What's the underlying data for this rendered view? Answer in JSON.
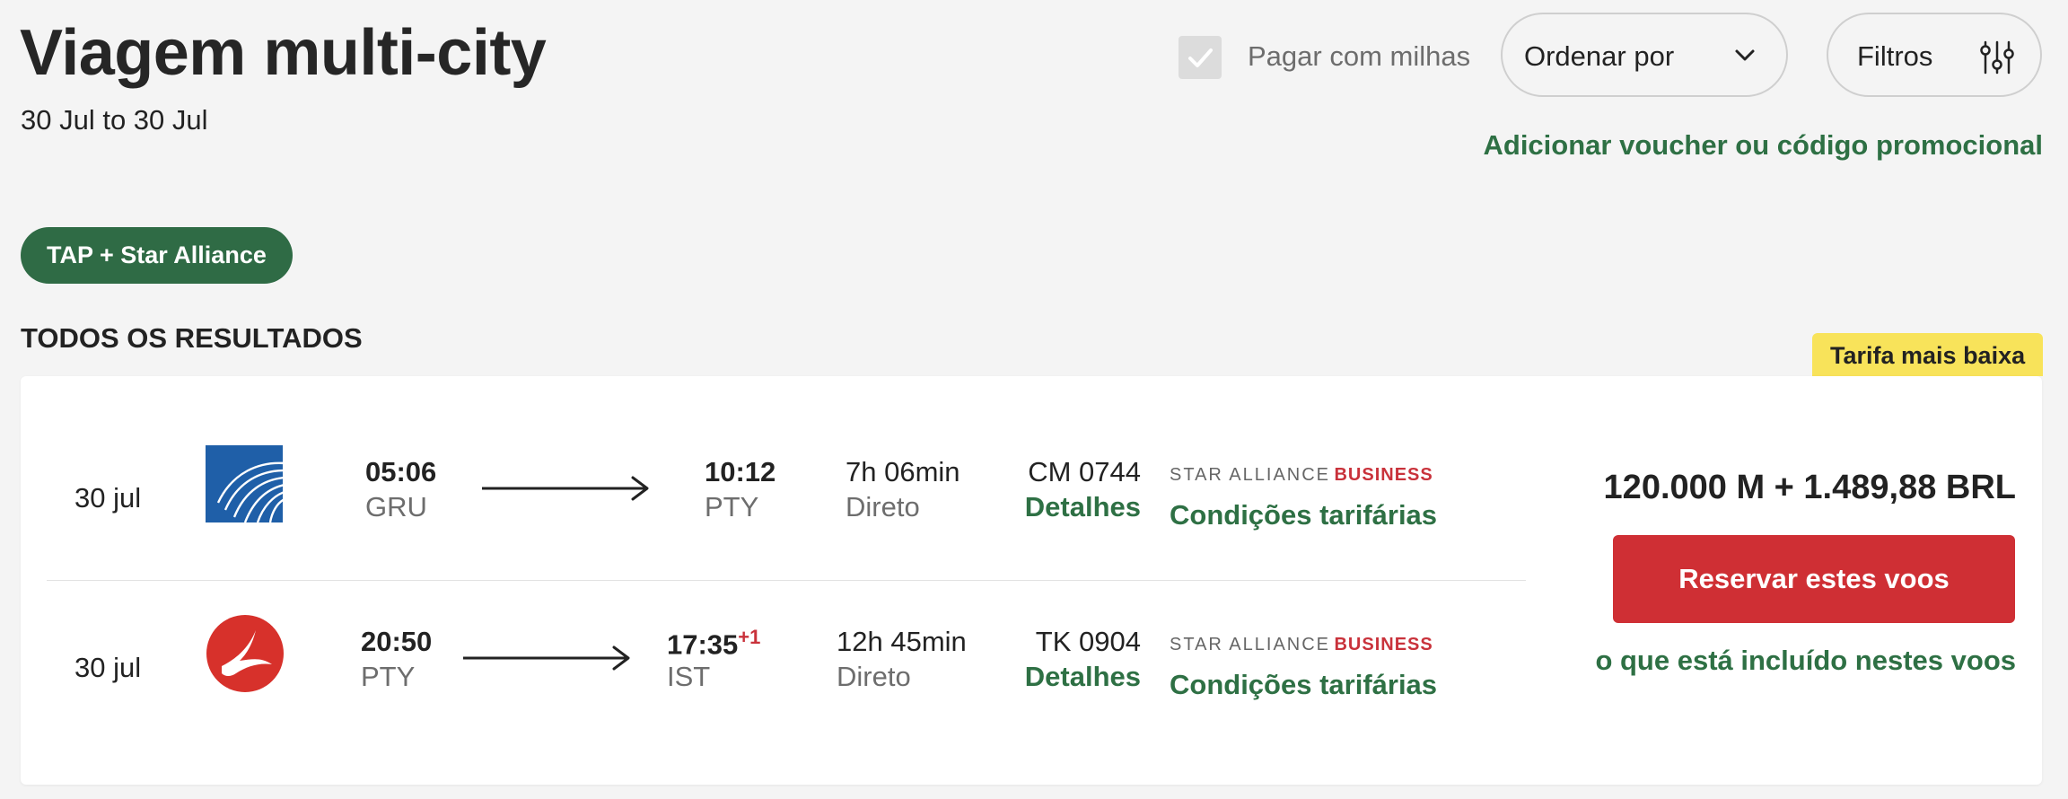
{
  "header": {
    "title": "Viagem multi-city",
    "subtitle": "30 Jul to 30 Jul"
  },
  "controls": {
    "pay_with_miles_label": "Pagar com milhas",
    "pay_with_miles_checked": true,
    "sort_label": "Ordenar por",
    "filters_label": "Filtros",
    "voucher_link": "Adicionar voucher ou código promocional"
  },
  "filter_chip": "TAP + Star Alliance",
  "results_heading": "TODOS OS RESULTADOS",
  "badge": "Tarifa mais baixa",
  "result": {
    "segments": [
      {
        "date": "30 jul",
        "airline_icon": "copa-airlines-logo",
        "depart_time": "05:06",
        "depart_code": "GRU",
        "arrive_time": "10:12",
        "arrive_day_offset": "",
        "arrive_code": "PTY",
        "duration": "7h 06min",
        "stops": "Direto",
        "flight_number": "CM 0744",
        "details_link": "Detalhes",
        "alliance": "STAR ALLIANCE",
        "cabin": "BUSINESS",
        "fare_conditions": "Condições tarifárias"
      },
      {
        "date": "30 jul",
        "airline_icon": "turkish-airlines-logo",
        "depart_time": "20:50",
        "depart_code": "PTY",
        "arrive_time": "17:35",
        "arrive_day_offset": "+1",
        "arrive_code": "IST",
        "duration": "12h 45min",
        "stops": "Direto",
        "flight_number": "TK 0904",
        "details_link": "Detalhes",
        "alliance": "STAR ALLIANCE",
        "cabin": "BUSINESS",
        "fare_conditions": "Condições tarifárias"
      }
    ],
    "price": "120.000 M + 1.489,88 BRL",
    "book_button": "Reservar estes voos",
    "included_link": "o que está incluído nestes voos"
  },
  "colors": {
    "brand_green": "#2e7044",
    "chip_green": "#2f6b45",
    "book_red": "#cf2f34",
    "badge_yellow": "#f8e35a",
    "copa_blue": "#1f5fa8",
    "turkish_red": "#d7312b"
  }
}
